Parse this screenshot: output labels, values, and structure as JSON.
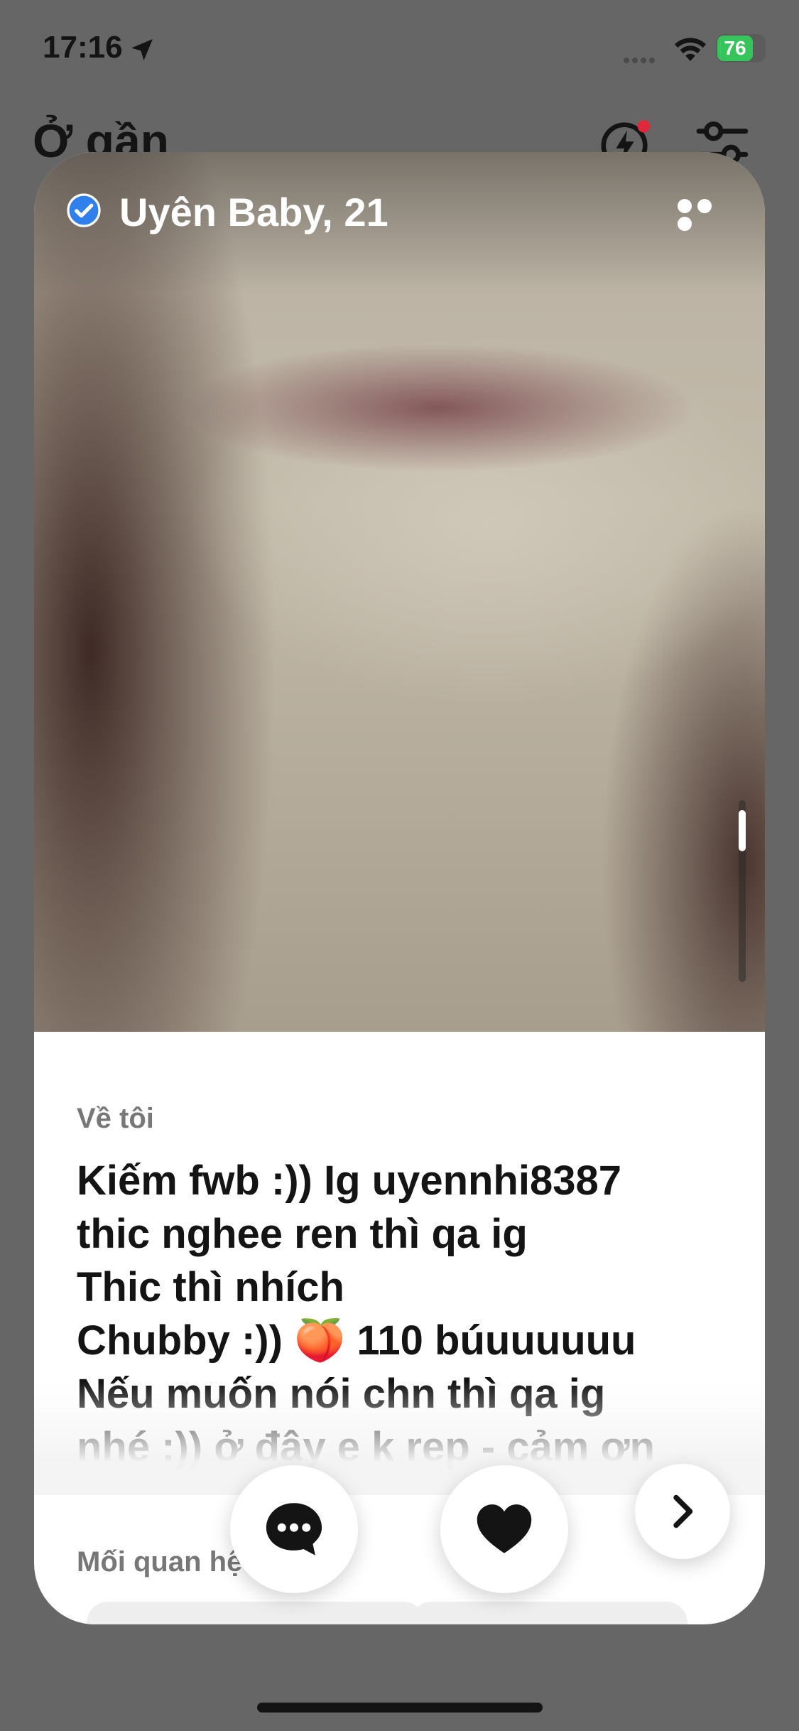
{
  "status_bar": {
    "time": "17:16",
    "battery": "76"
  },
  "header": {
    "title": "Ở gần"
  },
  "profile": {
    "name_age": "Uyên Baby, 21",
    "about_label": "Về tôi",
    "bio": "Kiếm fwb :)) Ig uyennhi8387\nthic nghee ren thì qa ig\nThic thì nhích\nChubby :)) 🍑 110 búuuuuuu\nNếu muốn nói chn thì qa ig\nnhé :)) ở đây e k rep - cảm ơn",
    "relationship_label": "Mối quan hệ của tôi"
  },
  "colors": {
    "verified": "#2f80ed",
    "battery": "#37c55b",
    "boost_dot": "#e0283b"
  },
  "icons": [
    "location-arrow-icon",
    "wifi-icon",
    "battery-icon",
    "boost-icon",
    "filter-icon",
    "verified-icon",
    "more-icon",
    "chat-icon",
    "heart-icon",
    "chevron-right-icon"
  ]
}
